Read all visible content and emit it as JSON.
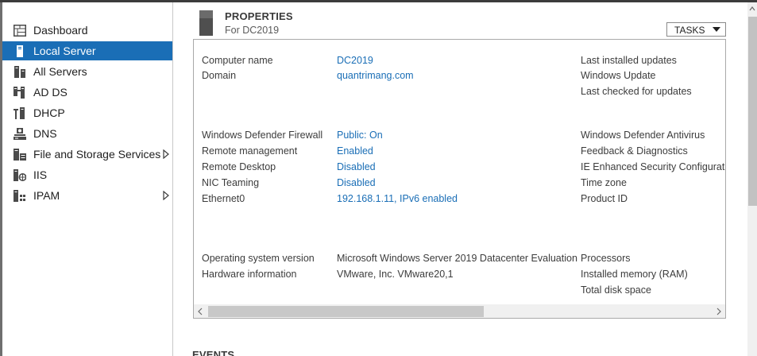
{
  "sidebar": {
    "items": [
      {
        "label": "Dashboard",
        "icon": "dashboard-icon",
        "active": false
      },
      {
        "label": "Local Server",
        "icon": "server-icon",
        "active": true
      },
      {
        "label": "All Servers",
        "icon": "servers-icon",
        "active": false
      },
      {
        "label": "AD DS",
        "icon": "ad-ds-icon",
        "active": false
      },
      {
        "label": "DHCP",
        "icon": "dhcp-icon",
        "active": false
      },
      {
        "label": "DNS",
        "icon": "dns-icon",
        "active": false
      },
      {
        "label": "File and Storage Services",
        "icon": "file-storage-icon",
        "active": false,
        "has_submenu": true
      },
      {
        "label": "IIS",
        "icon": "iis-icon",
        "active": false
      },
      {
        "label": "IPAM",
        "icon": "ipam-icon",
        "active": false,
        "has_submenu": true
      }
    ]
  },
  "properties": {
    "title": "PROPERTIES",
    "subtitle": "For DC2019",
    "tasks_label": "TASKS",
    "left": [
      {
        "label": "Computer name",
        "value": "DC2019",
        "link": true
      },
      {
        "label": "Domain",
        "value": "quantrimang.com",
        "link": true
      },
      {
        "label": "Windows Defender Firewall",
        "value": "Public: On",
        "link": true
      },
      {
        "label": "Remote management",
        "value": "Enabled",
        "link": true
      },
      {
        "label": "Remote Desktop",
        "value": "Disabled",
        "link": true
      },
      {
        "label": "NIC Teaming",
        "value": "Disabled",
        "link": true
      },
      {
        "label": "Ethernet0",
        "value": "192.168.1.11, IPv6 enabled",
        "link": true
      },
      {
        "label": "Operating system version",
        "value": "Microsoft Windows Server 2019 Datacenter Evaluation",
        "link": false
      },
      {
        "label": "Hardware information",
        "value": "VMware, Inc. VMware20,1",
        "link": false
      }
    ],
    "right": [
      "Last installed updates",
      "Windows Update",
      "Last checked for updates",
      "Windows Defender Antivirus",
      "Feedback & Diagnostics",
      "IE Enhanced Security Configuration",
      "Time zone",
      "Product ID",
      "Processors",
      "Installed memory (RAM)",
      "Total disk space"
    ]
  },
  "events": {
    "title": "EVENTS"
  },
  "colors": {
    "accent": "#1a6eb6",
    "link": "#1a6eb6",
    "sidebar_active_bg": "#1a6eb6",
    "border": "#a9a9a9"
  }
}
